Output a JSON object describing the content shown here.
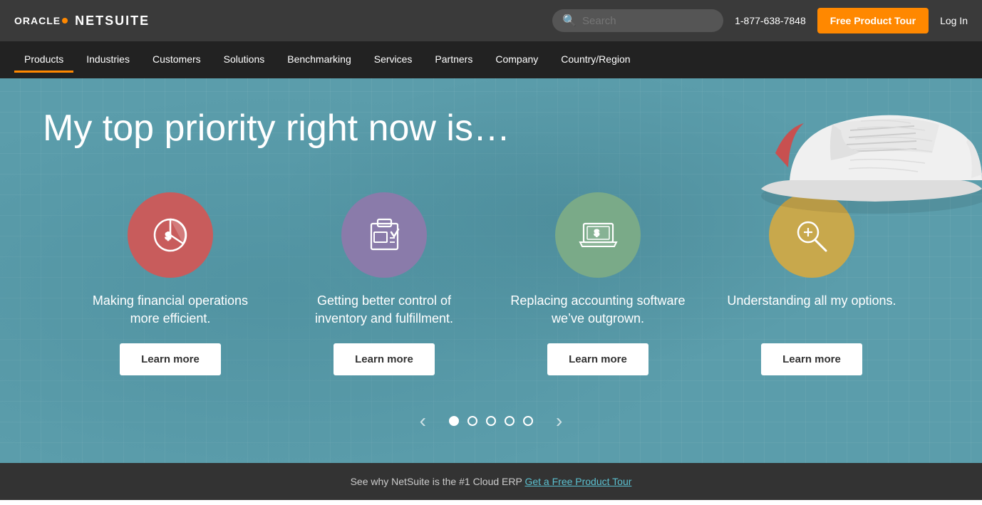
{
  "logo": {
    "oracle_text": "ORACLE",
    "netsuite_text": "NETSUITE"
  },
  "topbar": {
    "search_placeholder": "Search",
    "phone": "1-877-638-7848",
    "free_tour_label": "Free Product Tour",
    "login_label": "Log In"
  },
  "nav": {
    "items": [
      {
        "label": "Products",
        "active": true
      },
      {
        "label": "Industries",
        "active": false
      },
      {
        "label": "Customers",
        "active": false
      },
      {
        "label": "Solutions",
        "active": false
      },
      {
        "label": "Benchmarking",
        "active": false
      },
      {
        "label": "Services",
        "active": false
      },
      {
        "label": "Partners",
        "active": false
      },
      {
        "label": "Company",
        "active": false
      },
      {
        "label": "Country/Region",
        "active": false
      }
    ]
  },
  "hero": {
    "title": "My top priority right now is…",
    "cards": [
      {
        "id": "financial",
        "icon_color": "#c85c5c",
        "text": "Making financial operations more efficient.",
        "btn_label": "Learn more"
      },
      {
        "id": "inventory",
        "icon_color": "#8a7baa",
        "text": "Getting better control of inventory and fulfillment.",
        "btn_label": "Learn more"
      },
      {
        "id": "accounting",
        "icon_color": "#7aaa88",
        "text": "Replacing accounting software we’ve outgrown.",
        "btn_label": "Learn more"
      },
      {
        "id": "options",
        "icon_color": "#c8a84c",
        "text": "Understanding all my options.",
        "btn_label": "Learn more"
      }
    ],
    "carousel_dots": [
      {
        "active": true
      },
      {
        "active": false
      },
      {
        "active": false
      },
      {
        "active": false
      },
      {
        "active": false
      }
    ]
  },
  "footer": {
    "text": "See why NetSuite is the #1 Cloud ERP",
    "link_label": "Get a Free Product Tour"
  }
}
